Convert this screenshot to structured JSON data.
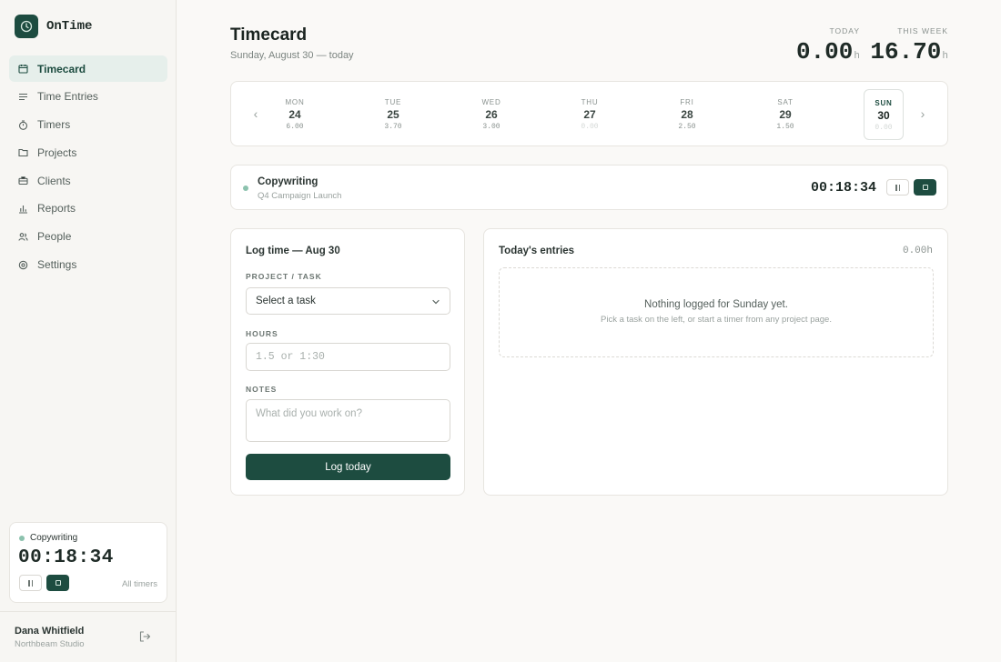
{
  "brand": {
    "name": "OnTime"
  },
  "nav": [
    {
      "label": "Timecard",
      "icon": "calendar-icon",
      "active": true
    },
    {
      "label": "Time Entries",
      "icon": "list-icon"
    },
    {
      "label": "Timers",
      "icon": "stopwatch-icon"
    },
    {
      "label": "Projects",
      "icon": "folder-icon"
    },
    {
      "label": "Clients",
      "icon": "briefcase-icon"
    },
    {
      "label": "Reports",
      "icon": "bar-chart-icon"
    },
    {
      "label": "People",
      "icon": "people-icon"
    },
    {
      "label": "Settings",
      "icon": "gear-icon"
    }
  ],
  "mini_timer": {
    "task": "Copywriting",
    "time": "00:18:34",
    "all_timers": "All timers"
  },
  "user": {
    "name": "Dana Whitfield",
    "org": "Northbeam Studio"
  },
  "header": {
    "title": "Timecard",
    "subtitle": "Sunday, August 30 — today"
  },
  "stats": {
    "today": {
      "label": "TODAY",
      "value": "0.00",
      "unit": "h"
    },
    "week": {
      "label": "THIS WEEK",
      "value": "16.70",
      "unit": "h"
    }
  },
  "week": {
    "prev": "‹",
    "next": "›",
    "days": [
      {
        "name": "MON",
        "date": "24",
        "hours": "6.00"
      },
      {
        "name": "TUE",
        "date": "25",
        "hours": "3.70"
      },
      {
        "name": "WED",
        "date": "26",
        "hours": "3.00"
      },
      {
        "name": "THU",
        "date": "27",
        "hours": "0.00"
      },
      {
        "name": "FRI",
        "date": "28",
        "hours": "2.50"
      },
      {
        "name": "SAT",
        "date": "29",
        "hours": "1.50"
      },
      {
        "name": "SUN",
        "date": "30",
        "hours": "0.00"
      }
    ]
  },
  "running": {
    "task": "Copywriting",
    "project": "Q4 Campaign Launch",
    "time": "00:18:34"
  },
  "log_form": {
    "title": "Log time — Aug 30",
    "project_label": "PROJECT / TASK",
    "project_value": "Select a task",
    "hours_label": "HOURS",
    "hours_placeholder": "1.5 or 1:30",
    "notes_label": "NOTES",
    "notes_placeholder": "What did you work on?",
    "submit": "Log today"
  },
  "entries": {
    "title": "Today's entries",
    "total": "0.00h",
    "empty_title": "Nothing logged for Sunday yet.",
    "empty_sub": "Pick a task on the left, or start a timer from any project page."
  },
  "colors": {
    "accent": "#1d4c40",
    "accent_light": "#e6efeb",
    "running_dot": "#8cc2ae"
  }
}
